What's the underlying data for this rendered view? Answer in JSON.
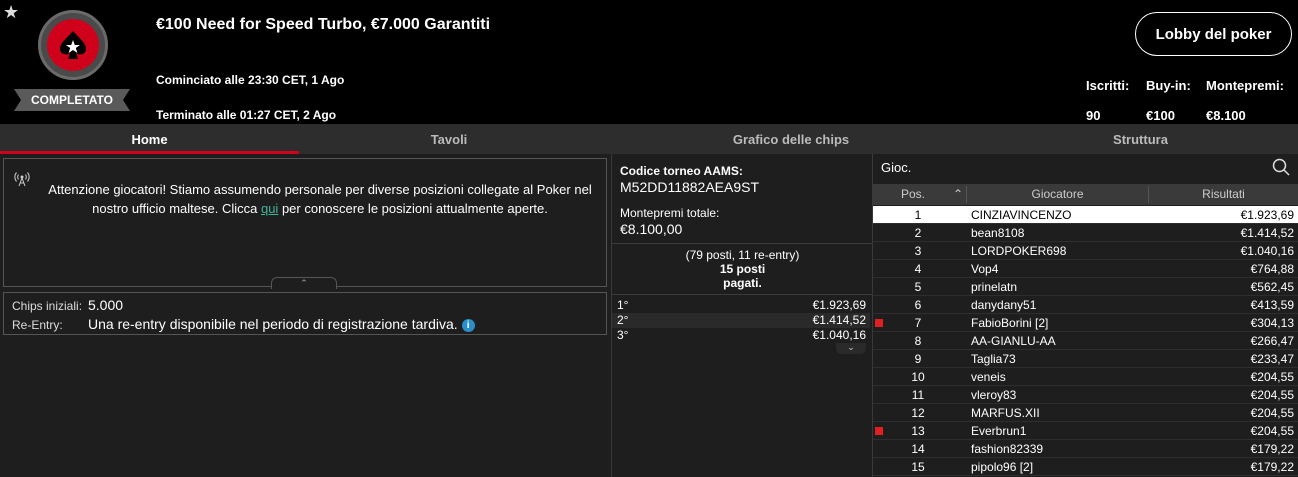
{
  "header": {
    "title": "€100 Need for Speed Turbo, €7.000 Garantiti",
    "status_badge": "COMPLETATO",
    "started": "Cominciato alle 23:30 CET, 1 Ago",
    "ended": "Terminato alle 01:27 CET, 2 Ago",
    "lobby_button": "Lobby del poker",
    "stats": {
      "entrants_label": "Iscritti:",
      "entrants": "90",
      "buyin_label": "Buy-in:",
      "buyin": "€100",
      "prizepool_label": "Montepremi:",
      "prizepool": "€8.100"
    }
  },
  "tabs": [
    {
      "label": "Home",
      "active": true
    },
    {
      "label": "Tavoli"
    },
    {
      "label": "Grafico delle chips"
    },
    {
      "label": "Struttura"
    }
  ],
  "announcement": {
    "text_before": "Attenzione giocatori! Stiamo assumendo personale per diverse posizioni collegate al Poker nel nostro ufficio maltese. Clicca ",
    "link": "qui",
    "text_after": " per conoscere le posizioni attualmente aperte."
  },
  "info": {
    "chips_label": "Chips iniziali:",
    "chips": "5.000",
    "reentry_label": "Re-Entry:",
    "reentry": "Una re-entry disponibile nel periodo di registrazione tardiva."
  },
  "middle": {
    "code_label": "Codice torneo AAMS:",
    "code": "M52DD11882AEA9ST",
    "prize_label": "Montepremi totale:",
    "prize": "€8.100,00",
    "seats_line1": "(79 posti, 11 re-entry)",
    "seats_line2": "15 posti",
    "seats_line3": "pagati.",
    "payouts": [
      {
        "place": "1°",
        "value": "€1.923,69"
      },
      {
        "place": "2°",
        "value": "€1.414,52"
      },
      {
        "place": "3°",
        "value": "€1.040,16"
      }
    ]
  },
  "players": {
    "search_label": "Gioc.",
    "col_pos": "Pos.",
    "col_player": "Giocatore",
    "col_result": "Risultati",
    "rows": [
      {
        "pos": "1",
        "name": "CINZIAVINCENZO",
        "result": "€1.923,69"
      },
      {
        "pos": "2",
        "name": "bean8108",
        "result": "€1.414,52"
      },
      {
        "pos": "3",
        "name": "LORDPOKER698",
        "result": "€1.040,16"
      },
      {
        "pos": "4",
        "name": "Vop4",
        "result": "€764,88"
      },
      {
        "pos": "5",
        "name": "prinelatn",
        "result": "€562,45"
      },
      {
        "pos": "6",
        "name": "danydany51",
        "result": "€413,59"
      },
      {
        "pos": "7",
        "name": "FabioBorini [2]",
        "result": "€304,13",
        "flag": true
      },
      {
        "pos": "8",
        "name": "AA-GIANLU-AA",
        "result": "€266,47"
      },
      {
        "pos": "9",
        "name": "Taglia73",
        "result": "€233,47"
      },
      {
        "pos": "10",
        "name": "veneis",
        "result": "€204,55"
      },
      {
        "pos": "11",
        "name": "vleroy83",
        "result": "€204,55"
      },
      {
        "pos": "12",
        "name": "MARFUS.XII",
        "result": "€204,55"
      },
      {
        "pos": "13",
        "name": "Everbrun1",
        "result": "€204,55",
        "flag": true
      },
      {
        "pos": "14",
        "name": "fashion82339",
        "result": "€179,22"
      },
      {
        "pos": "15",
        "name": "pipolo96 [2]",
        "result": "€179,22"
      }
    ]
  }
}
